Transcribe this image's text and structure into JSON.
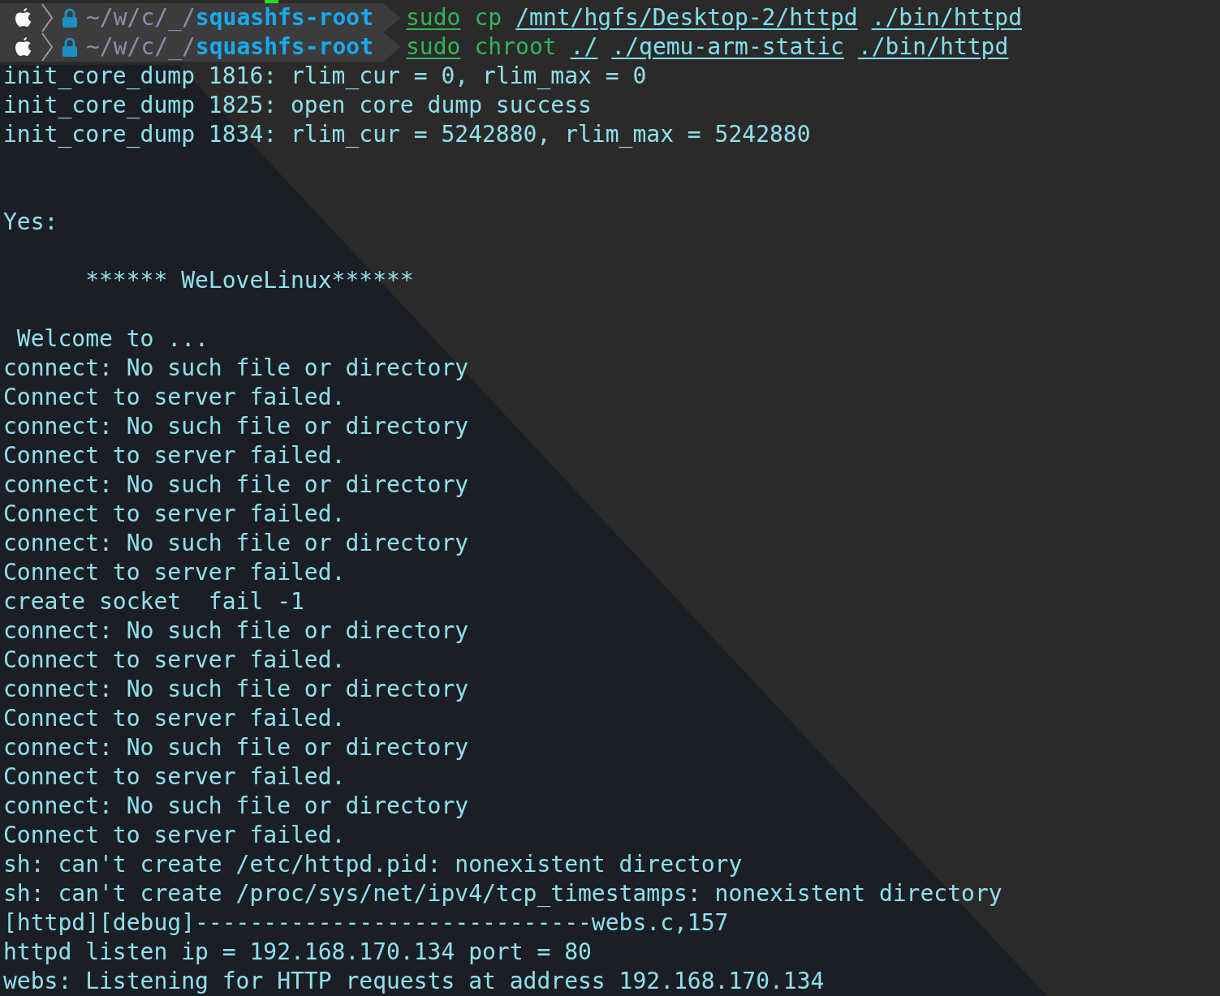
{
  "prompts": [
    {
      "path": "~/w/c/_/",
      "directory": "squashfs-root",
      "command": [
        {
          "text": "sudo",
          "kind": "command"
        },
        {
          "text": "cp",
          "kind": "word"
        },
        {
          "text": "/mnt/hgfs/Desktop-2/httpd",
          "kind": "path"
        },
        {
          "text": "./bin/httpd",
          "kind": "path"
        }
      ]
    },
    {
      "path": "~/w/c/_/",
      "directory": "squashfs-root",
      "command": [
        {
          "text": "sudo",
          "kind": "command"
        },
        {
          "text": "chroot",
          "kind": "word"
        },
        {
          "text": "./",
          "kind": "path"
        },
        {
          "text": "./qemu-arm-static",
          "kind": "path"
        },
        {
          "text": "./bin/httpd",
          "kind": "path"
        }
      ]
    }
  ],
  "output": [
    {
      "kind": "text",
      "text": "init_core_dump 1816: rlim_cur = 0, rlim_max = 0"
    },
    {
      "kind": "text",
      "text": "init_core_dump 1825: open core dump success"
    },
    {
      "kind": "text",
      "text": "init_core_dump 1834: rlim_cur = 5242880, rlim_max = 5242880"
    },
    {
      "kind": "blank"
    },
    {
      "kind": "blank"
    },
    {
      "kind": "text",
      "text": "Yes:"
    },
    {
      "kind": "blank"
    },
    {
      "kind": "text",
      "text": "      ****** WeLoveLinux******"
    },
    {
      "kind": "blank"
    },
    {
      "kind": "text",
      "text": " Welcome to ..."
    },
    {
      "kind": "text",
      "text": "connect: No such file or directory"
    },
    {
      "kind": "text",
      "text": "Connect to server failed."
    },
    {
      "kind": "text",
      "text": "connect: No such file or directory"
    },
    {
      "kind": "text",
      "text": "Connect to server failed."
    },
    {
      "kind": "text",
      "text": "connect: No such file or directory"
    },
    {
      "kind": "text",
      "text": "Connect to server failed."
    },
    {
      "kind": "text",
      "text": "connect: No such file or directory"
    },
    {
      "kind": "text",
      "text": "Connect to server failed."
    },
    {
      "kind": "text",
      "text": "create socket  fail -1"
    },
    {
      "kind": "text",
      "text": "connect: No such file or directory"
    },
    {
      "kind": "text",
      "text": "Connect to server failed."
    },
    {
      "kind": "text",
      "text": "connect: No such file or directory"
    },
    {
      "kind": "text",
      "text": "Connect to server failed."
    },
    {
      "kind": "text",
      "text": "connect: No such file or directory"
    },
    {
      "kind": "text",
      "text": "Connect to server failed."
    },
    {
      "kind": "text",
      "text": "connect: No such file or directory"
    },
    {
      "kind": "text",
      "text": "Connect to server failed."
    },
    {
      "kind": "text",
      "text": "sh: can't create /etc/httpd.pid: nonexistent directory"
    },
    {
      "kind": "text",
      "text": "sh: can't create /proc/sys/net/ipv4/tcp_timestamps: nonexistent directory"
    },
    {
      "kind": "text",
      "text": "[httpd][debug]-----------------------------webs.c,157"
    },
    {
      "kind": "text",
      "text": "httpd listen ip = 192.168.170.134 port = 80"
    },
    {
      "kind": "text",
      "text": "webs: Listening for HTTP requests at address 192.168.170.134"
    }
  ]
}
